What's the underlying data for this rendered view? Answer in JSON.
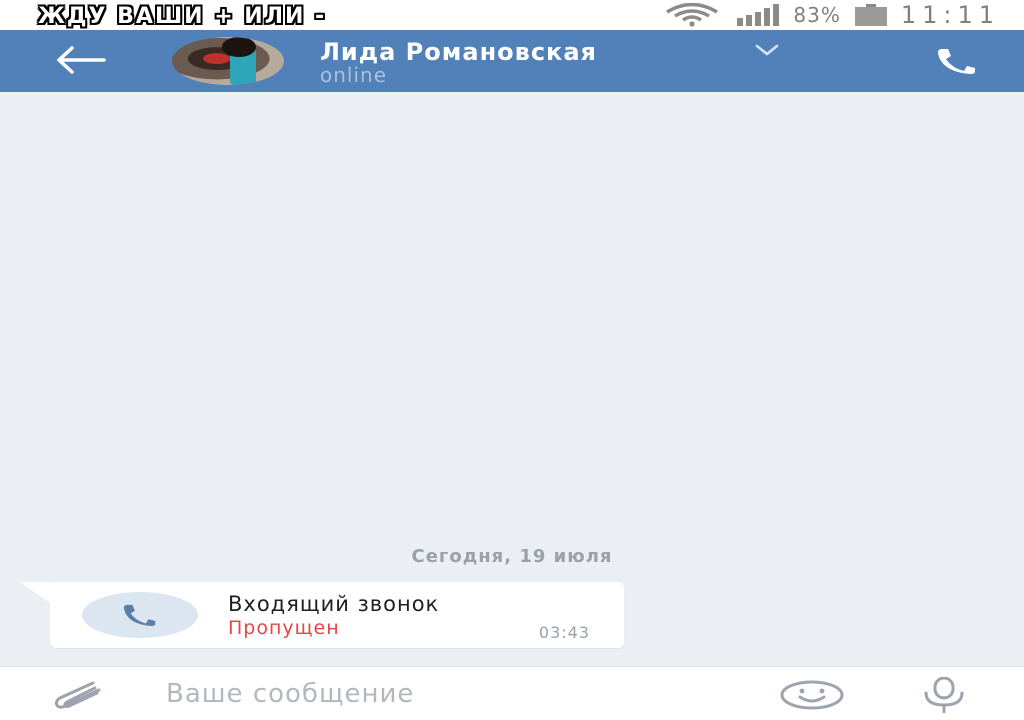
{
  "overlay_caption": "ЖДУ ВАШИ + ИЛИ -",
  "status_bar": {
    "battery_percent": "83%",
    "time": "11:11",
    "icons": [
      "wifi-icon",
      "signal-icon",
      "battery-icon"
    ]
  },
  "header": {
    "contact_name": "Лида Романовская",
    "contact_status": "online",
    "background_color": "#5181b8",
    "icons": [
      "back-arrow-icon",
      "avatar",
      "chevron-down-icon",
      "phone-icon"
    ]
  },
  "conversation": {
    "date_label": "Сегодня, 19 июля",
    "messages": [
      {
        "type": "call",
        "title": "Входящий звонок",
        "status": "Пропущен",
        "status_color": "#e64646",
        "time": "03:43",
        "icon": "phone-icon"
      }
    ]
  },
  "composer": {
    "placeholder": "Ваше сообщение",
    "value": "",
    "icons": [
      "paperclip-icon",
      "smiley-icon",
      "microphone-icon"
    ]
  }
}
